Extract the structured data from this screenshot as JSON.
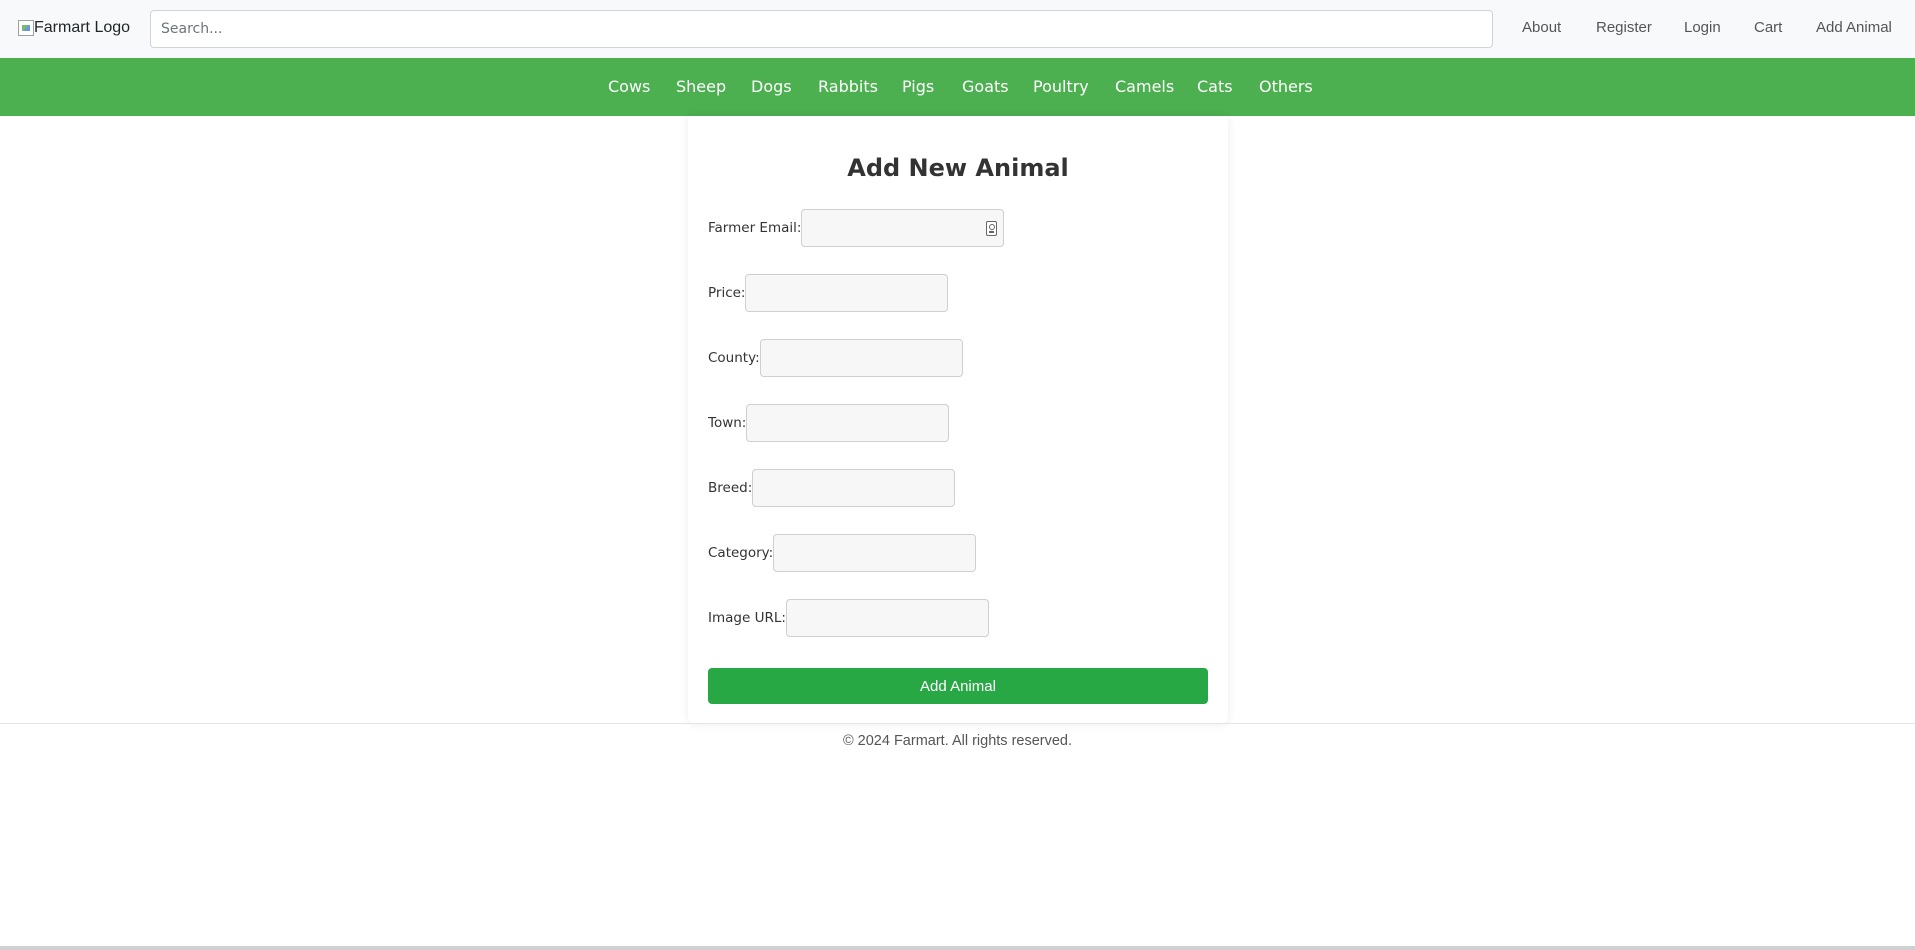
{
  "header": {
    "logo_alt": "Farmart Logo",
    "search_placeholder": "Search...",
    "nav": {
      "about": "About",
      "register": "Register",
      "login": "Login",
      "cart": "Cart",
      "add_animal": "Add Animal"
    }
  },
  "categories": {
    "cows": "Cows",
    "sheep": "Sheep",
    "dogs": "Dogs",
    "rabbits": "Rabbits",
    "pigs": "Pigs",
    "goats": "Goats",
    "poultry": "Poultry",
    "camels": "Camels",
    "cats": "Cats",
    "others": "Others"
  },
  "form": {
    "title": "Add New Animal",
    "fields": {
      "farmer_email": {
        "label": "Farmer Email:",
        "value": ""
      },
      "price": {
        "label": "Price:",
        "value": ""
      },
      "county": {
        "label": "County:",
        "value": ""
      },
      "town": {
        "label": "Town:",
        "value": ""
      },
      "breed": {
        "label": "Breed:",
        "value": ""
      },
      "category": {
        "label": "Category:",
        "value": ""
      },
      "image_url": {
        "label": "Image URL:",
        "value": ""
      }
    },
    "submit_label": "Add Animal"
  },
  "footer": {
    "text": "© 2024 Farmart. All rights reserved."
  },
  "colors": {
    "category_bar": "#4caf50",
    "submit_button": "#28a745",
    "header_bg": "#f8f9fa"
  },
  "icons": {
    "logo": "broken-image-icon",
    "email_autofill": "contact-card-icon"
  }
}
